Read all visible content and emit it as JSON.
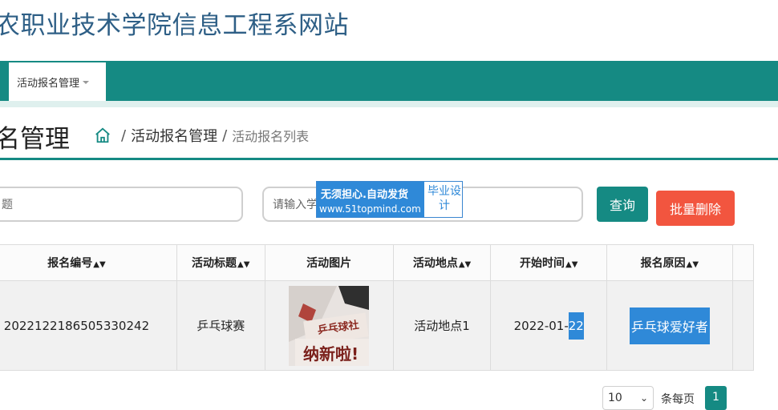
{
  "site": {
    "title": "农职业技术学院信息工程系网站"
  },
  "nav": {
    "items": [
      {
        "label": "活动报名管理"
      }
    ]
  },
  "header": {
    "title": "名管理",
    "breadcrumb": {
      "parent": "活动报名管理",
      "current": "活动报名列表"
    }
  },
  "search": {
    "field1_placeholder": "题",
    "field2_placeholder": "请输入学"
  },
  "watermark": {
    "line1": "无须担心.自动发货",
    "line2": "www.51topmind.com",
    "badge": "毕业设计"
  },
  "buttons": {
    "search": "查询",
    "batch_delete": "批量删除"
  },
  "table": {
    "columns": [
      "报名编号",
      "活动标题",
      "活动图片",
      "活动地点",
      "开始时间",
      "报名原因"
    ],
    "rows": [
      {
        "code": "2022122186505330242",
        "title": "乒乓球赛",
        "location": "活动地点1",
        "start_time_a": "2022-01-",
        "start_time_b": "22",
        "reason": "乒乓球爱好者"
      }
    ]
  },
  "thumbnail": {
    "text_top": "乒乓球社",
    "text_bottom": "纳新啦!"
  },
  "pagination": {
    "page_size": "10",
    "per_page_label": "条每页",
    "current_page": "1"
  },
  "colors": {
    "primary": "#158a83",
    "danger": "#f2553f",
    "highlight": "#2f89d8"
  }
}
